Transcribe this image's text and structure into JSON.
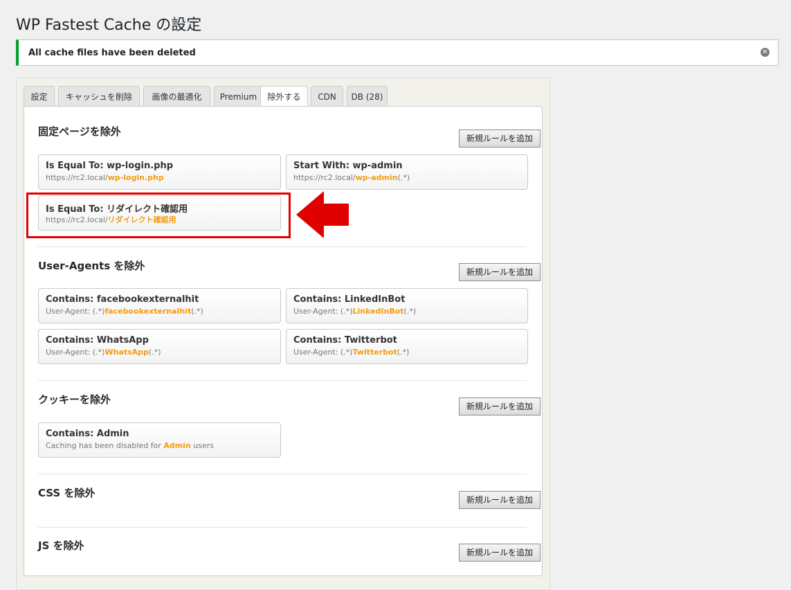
{
  "title": "WP Fastest Cache の設定",
  "notice": {
    "text": "All cache files have been deleted",
    "dismiss_icon": "close-circle-icon"
  },
  "tabs": [
    {
      "label": "設定"
    },
    {
      "label": "キャッシュを削除"
    },
    {
      "label": "画像の最適化"
    },
    {
      "label": "Premium"
    },
    {
      "label": "除外する",
      "active": true
    },
    {
      "label": "CDN"
    },
    {
      "label": "DB (28)"
    }
  ],
  "add_rule_label": "新規ルールを追加",
  "sections": {
    "pages": {
      "title": "固定ページを除外",
      "rules": [
        {
          "title": "Is Equal To: wp-login.php",
          "prefix": "https://rc2.local/",
          "highlight": "wp-login.php",
          "suffix": ""
        },
        {
          "title": "Start With: wp-admin",
          "prefix": "https://rc2.local/",
          "highlight": "wp-admin",
          "suffix": "(.*)"
        },
        {
          "title": "Is Equal To: リダイレクト確認用",
          "prefix": "https://rc2.local/",
          "highlight": "リダイレクト確認用",
          "suffix": ""
        }
      ]
    },
    "useragents": {
      "title": "User-Agents を除外",
      "rules": [
        {
          "title": "Contains: facebookexternalhit",
          "prefix": "User-Agent: (.*)",
          "highlight": "facebookexternalhit",
          "suffix": "(.*)"
        },
        {
          "title": "Contains: LinkedInBot",
          "prefix": "User-Agent: (.*)",
          "highlight": "LinkedInBot",
          "suffix": "(.*)"
        },
        {
          "title": "Contains: WhatsApp",
          "prefix": "User-Agent: (.*)",
          "highlight": "WhatsApp",
          "suffix": "(.*)"
        },
        {
          "title": "Contains: Twitterbot",
          "prefix": "User-Agent: (.*)",
          "highlight": "Twitterbot",
          "suffix": "(.*)"
        }
      ]
    },
    "cookies": {
      "title": "クッキーを除外",
      "rules": [
        {
          "title": "Contains: Admin",
          "prefix": "Caching has been disabled for ",
          "highlight": "Admin",
          "suffix": " users"
        }
      ]
    },
    "css": {
      "title": "CSS を除外"
    },
    "js": {
      "title": "JS を除外"
    }
  },
  "colors": {
    "accent": "#f29c11",
    "notice_border": "#00a32a",
    "annotation_red": "#e00000"
  }
}
